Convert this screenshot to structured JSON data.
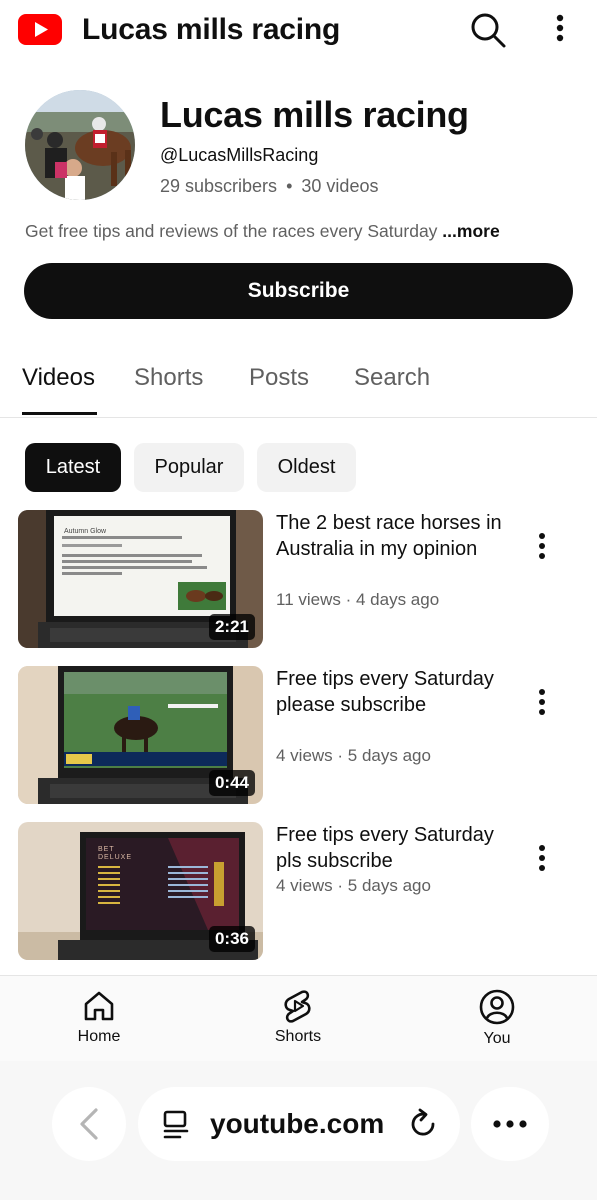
{
  "topbar": {
    "title": "Lucas mills racing"
  },
  "channel": {
    "name": "Lucas mills racing",
    "handle": "@LucasMillsRacing",
    "subscribers": "29 subscribers",
    "separator": "•",
    "videos_count": "30 videos",
    "description": "Get free tips and reviews of the races every Saturday",
    "more_label": "...more",
    "subscribe_label": "Subscribe"
  },
  "tabs": [
    {
      "label": "Videos",
      "active": true
    },
    {
      "label": "Shorts",
      "active": false
    },
    {
      "label": "Posts",
      "active": false
    },
    {
      "label": "Search",
      "active": false
    }
  ],
  "chips": [
    {
      "label": "Latest",
      "active": true
    },
    {
      "label": "Popular",
      "active": false
    },
    {
      "label": "Oldest",
      "active": false
    }
  ],
  "videos": [
    {
      "title": "The 2 best race horses in Australia in my opinion",
      "meta": "11 views · 4 days ago",
      "duration": "2:21",
      "thumb_caption": "Autumn Glow"
    },
    {
      "title": "Free tips every Saturday please subscribe",
      "meta": "4 views · 5 days ago",
      "duration": "0:44"
    },
    {
      "title": "Free tips every Saturday pls subscribe",
      "meta": "4 views · 5 days ago",
      "duration": "0:36",
      "thumb_caption": "BET DELUXE"
    }
  ],
  "bottom_nav": [
    {
      "label": "Home",
      "icon": "home-icon"
    },
    {
      "label": "Shorts",
      "icon": "shorts-icon"
    },
    {
      "label": "You",
      "icon": "you-icon"
    }
  ],
  "browser": {
    "url": "youtube.com"
  },
  "colors": {
    "brand_red": "#ff0000",
    "text_primary": "#0f0f0f",
    "text_secondary": "#606060",
    "chip_bg": "#f2f2f2"
  }
}
